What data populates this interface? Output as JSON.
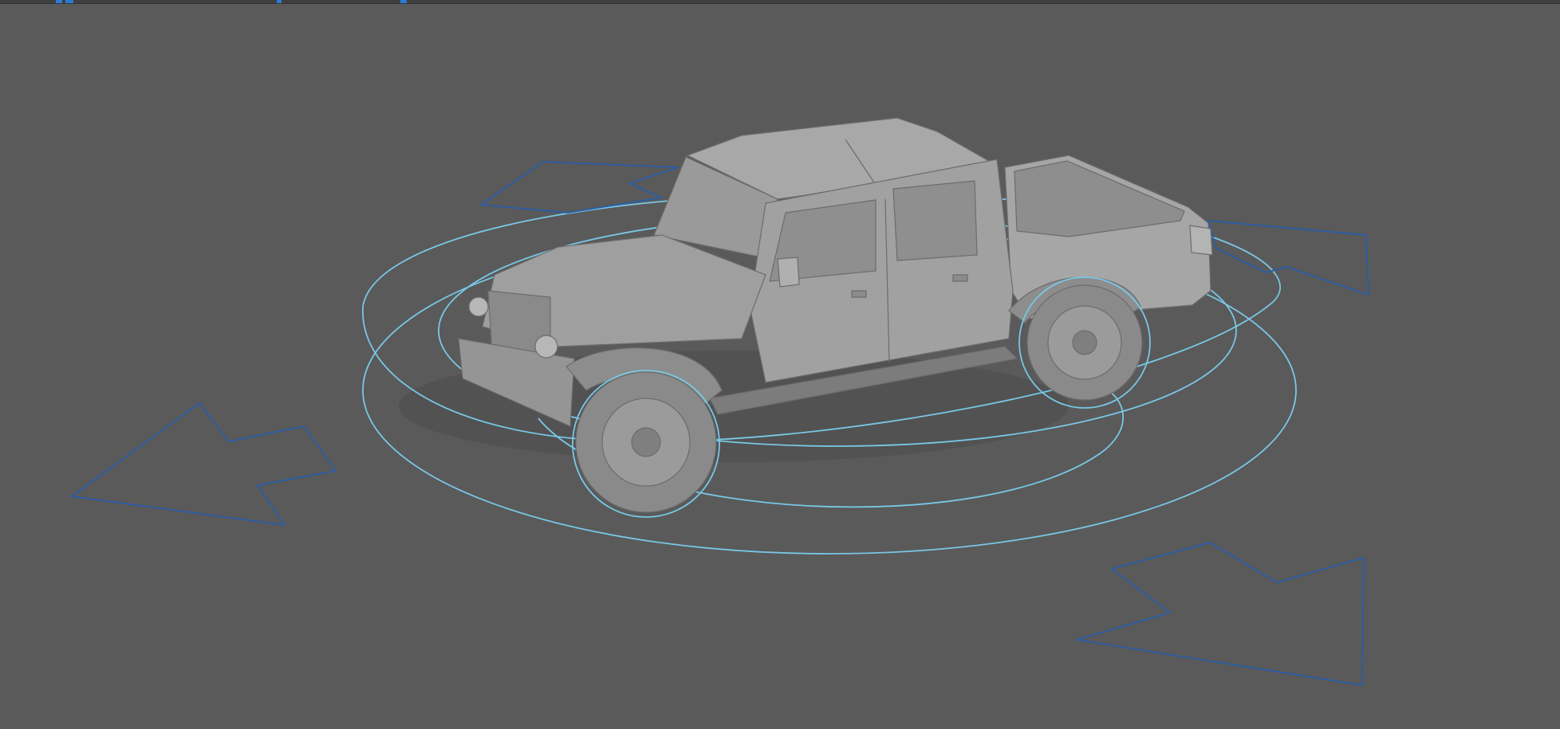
{
  "viewport": {
    "mode": "perspective",
    "shading": "shaded",
    "background": "#5a5a5a"
  },
  "scene": {
    "model": "pickup-truck",
    "gizmo": "rotate-gizmo",
    "gizmo_color": "#79c7e6",
    "arrow_color": "#2a5da8",
    "model_color": "#9b9b9b"
  }
}
